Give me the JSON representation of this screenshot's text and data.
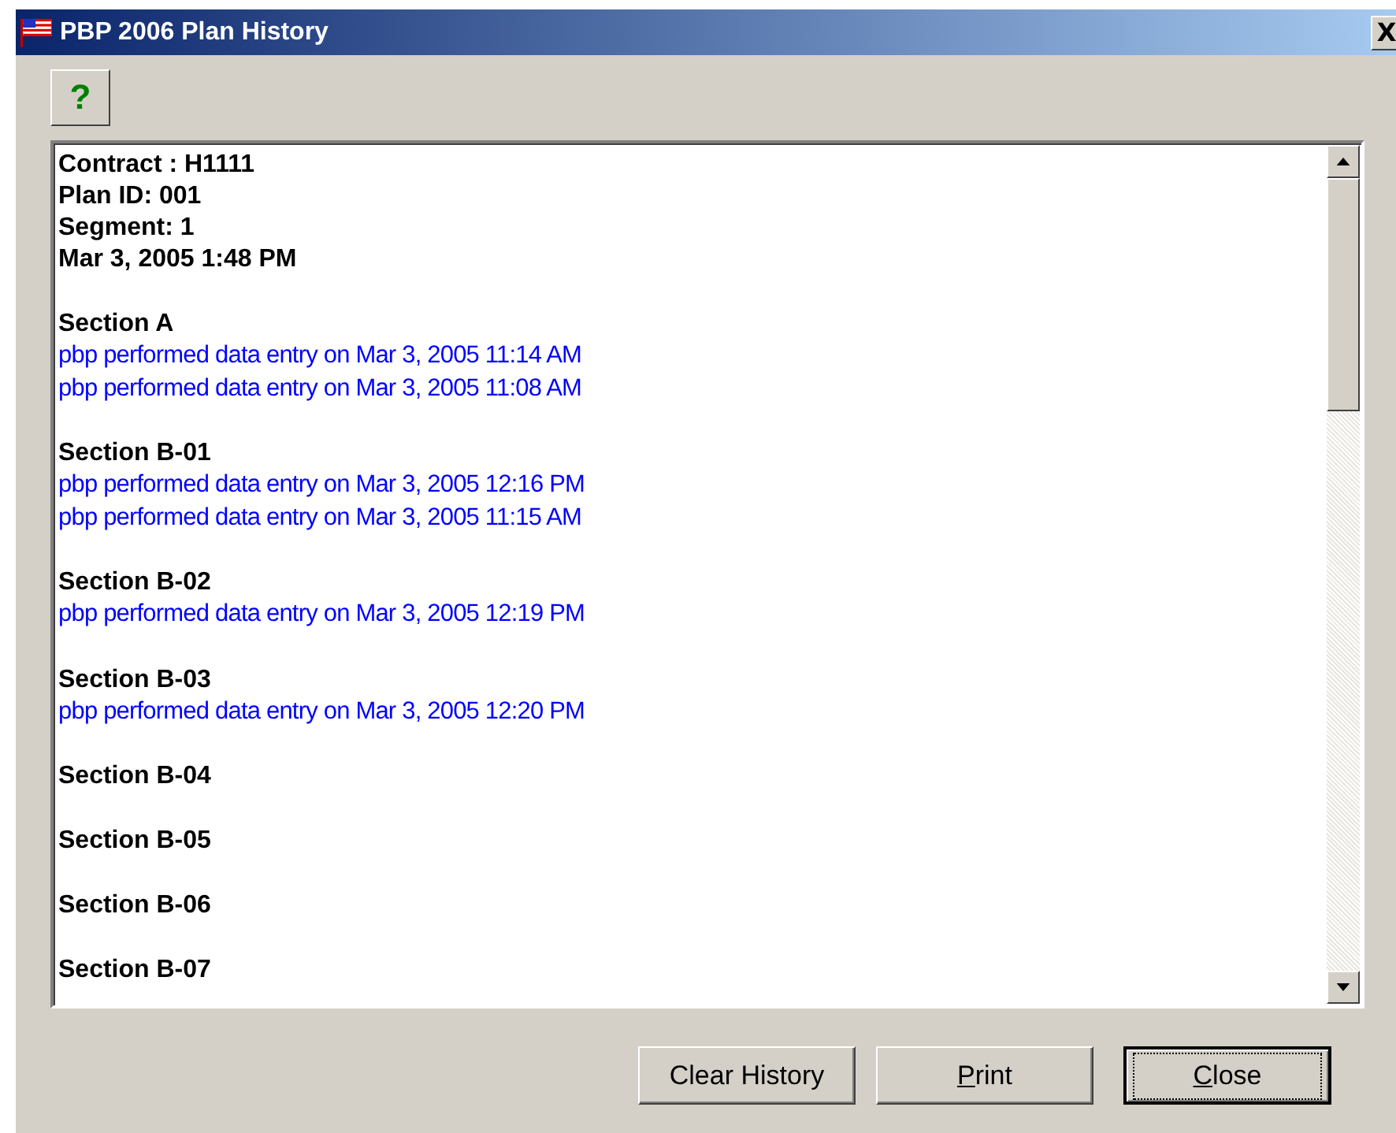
{
  "window": {
    "title": "PBP 2006 Plan History",
    "close_glyph": "X"
  },
  "help_button": {
    "label": "?"
  },
  "header_lines": [
    "Contract :  H1111",
    "Plan ID:  001",
    "Segment:  1",
    "Mar 3, 2005 1:48 PM"
  ],
  "sections": [
    {
      "title": "Section A",
      "entries": [
        "pbp performed data entry on Mar 3, 2005 11:14 AM",
        "pbp performed data entry on Mar 3, 2005 11:08 AM"
      ]
    },
    {
      "title": "Section B-01",
      "entries": [
        "pbp performed data entry on Mar 3, 2005 12:16 PM",
        "pbp performed data entry on Mar 3, 2005 11:15 AM"
      ]
    },
    {
      "title": "Section B-02",
      "entries": [
        "pbp performed data entry on Mar 3, 2005 12:19 PM"
      ]
    },
    {
      "title": "Section B-03",
      "entries": [
        "pbp performed data entry on Mar 3, 2005 12:20 PM"
      ]
    },
    {
      "title": "Section B-04"
    },
    {
      "title": "Section B-05"
    },
    {
      "title": "Section B-06"
    },
    {
      "title": "Section B-07"
    }
  ],
  "buttons": [
    {
      "rest": "Clear History",
      "default": false
    },
    {
      "key": "P",
      "rest": "rint",
      "default": false
    },
    {
      "key": "C",
      "rest": "lose",
      "default": true
    }
  ]
}
